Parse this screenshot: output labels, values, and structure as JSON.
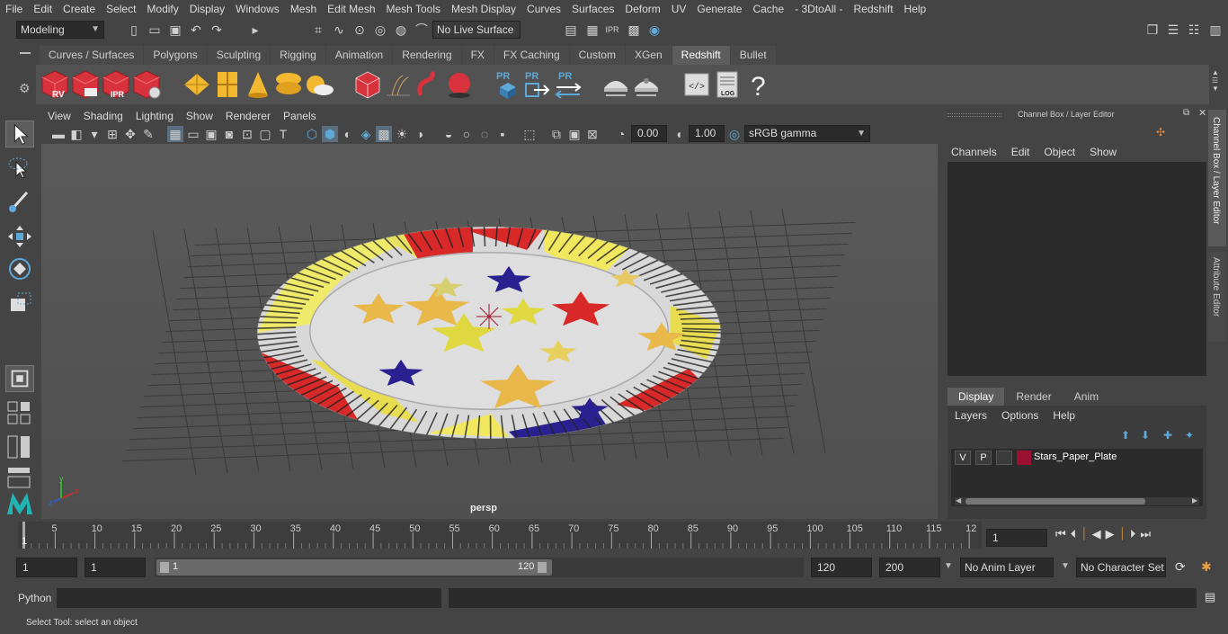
{
  "menus": [
    "File",
    "Edit",
    "Create",
    "Select",
    "Modify",
    "Display",
    "Windows",
    "Mesh",
    "Edit Mesh",
    "Mesh Tools",
    "Mesh Display",
    "Curves",
    "Surfaces",
    "Deform",
    "UV",
    "Generate",
    "Cache",
    "- 3DtoAll -",
    "Redshift",
    "Help"
  ],
  "status": {
    "workspace": "Modeling",
    "live_surface": "No Live Surface"
  },
  "shelf_tabs": [
    "Curves / Surfaces",
    "Polygons",
    "Sculpting",
    "Rigging",
    "Animation",
    "Rendering",
    "FX",
    "FX Caching",
    "Custom",
    "XGen",
    "Redshift",
    "Bullet"
  ],
  "shelf_active": "Redshift",
  "shelf_labels": {
    "rv": "RV",
    "ipr": "IPR",
    "pr": "PR",
    "log": "LOG",
    "help": "?"
  },
  "panel_menus": [
    "View",
    "Shading",
    "Lighting",
    "Show",
    "Renderer",
    "Panels"
  ],
  "panel_toolbar": {
    "exposure": "0.00",
    "gamma": "1.00",
    "color_space": "sRGB gamma"
  },
  "viewport": {
    "camera_label": "persp",
    "axis": {
      "x": "x",
      "y": "y",
      "z": "z"
    }
  },
  "channel_box": {
    "title": "Channel Box / Layer Editor",
    "menus": [
      "Channels",
      "Edit",
      "Object",
      "Show"
    ],
    "side_tabs": [
      "Channel Box / Layer Editor",
      "Attribute Editor"
    ]
  },
  "layer_editor": {
    "tabs": [
      "Display",
      "Render",
      "Anim"
    ],
    "active_tab": "Display",
    "menus": [
      "Layers",
      "Options",
      "Help"
    ],
    "layers": [
      {
        "v": "V",
        "p": "P",
        "name": "Stars_Paper_Plate",
        "color": "#9a1030"
      }
    ]
  },
  "timeline": {
    "ticks": [
      "5",
      "10",
      "15",
      "20",
      "25",
      "30",
      "35",
      "40",
      "45",
      "50",
      "55",
      "60",
      "65",
      "70",
      "75",
      "80",
      "85",
      "90",
      "95",
      "100",
      "105",
      "110",
      "115",
      "12"
    ],
    "current_frame_label": "1",
    "current_frame_field": "1"
  },
  "range": {
    "start": "1",
    "playback_start": "1",
    "slider_start": "1",
    "slider_end": "120",
    "playback_end": "120",
    "end": "200",
    "anim_layer": "No Anim Layer",
    "character_set": "No Character Set"
  },
  "command": {
    "label": "Python"
  },
  "help_line": "Select Tool: select an object",
  "colors": {
    "accent_blue": "#5ea9d8",
    "red_icon": "#d8323c",
    "yellow_icon": "#f2b930",
    "active_tab": "#5d5d5d"
  }
}
